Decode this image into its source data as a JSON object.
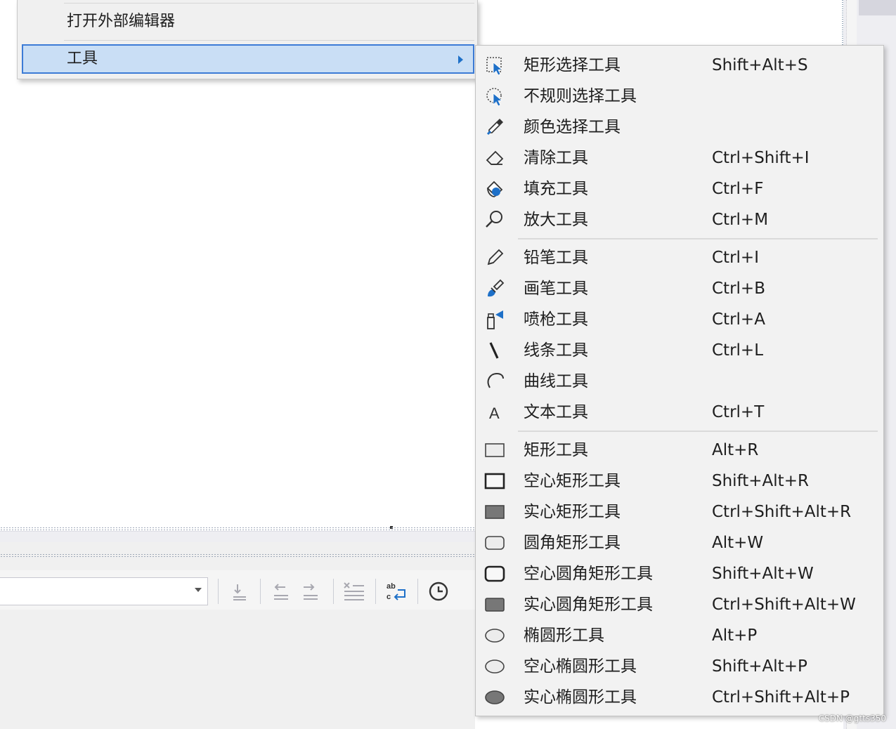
{
  "parent_menu": {
    "items": [
      {
        "label": "打开外部编辑器"
      },
      {
        "label": "工具"
      }
    ]
  },
  "submenu": {
    "groups": [
      [
        {
          "label": "矩形选择工具",
          "shortcut": "Shift+Alt+S",
          "icon": "rect-select-icon"
        },
        {
          "label": "不规则选择工具",
          "shortcut": "",
          "icon": "lasso-select-icon"
        },
        {
          "label": "颜色选择工具",
          "shortcut": "",
          "icon": "eyedropper-icon"
        },
        {
          "label": "清除工具",
          "shortcut": "Ctrl+Shift+I",
          "icon": "eraser-icon"
        },
        {
          "label": "填充工具",
          "shortcut": "Ctrl+F",
          "icon": "fill-bucket-icon"
        },
        {
          "label": "放大工具",
          "shortcut": "Ctrl+M",
          "icon": "zoom-icon"
        }
      ],
      [
        {
          "label": "铅笔工具",
          "shortcut": "Ctrl+I",
          "icon": "pencil-icon"
        },
        {
          "label": "画笔工具",
          "shortcut": "Ctrl+B",
          "icon": "brush-icon"
        },
        {
          "label": "喷枪工具",
          "shortcut": "Ctrl+A",
          "icon": "spray-icon"
        },
        {
          "label": "线条工具",
          "shortcut": "Ctrl+L",
          "icon": "line-icon"
        },
        {
          "label": "曲线工具",
          "shortcut": "",
          "icon": "curve-icon"
        },
        {
          "label": "文本工具",
          "shortcut": "Ctrl+T",
          "icon": "text-icon"
        }
      ],
      [
        {
          "label": "矩形工具",
          "shortcut": "Alt+R",
          "icon": "rect-icon"
        },
        {
          "label": "空心矩形工具",
          "shortcut": "Shift+Alt+R",
          "icon": "hollow-rect-icon"
        },
        {
          "label": "实心矩形工具",
          "shortcut": "Ctrl+Shift+Alt+R",
          "icon": "solid-rect-icon"
        },
        {
          "label": "圆角矩形工具",
          "shortcut": "Alt+W",
          "icon": "rounded-rect-icon"
        },
        {
          "label": "空心圆角矩形工具",
          "shortcut": "Shift+Alt+W",
          "icon": "hollow-rounded-rect-icon"
        },
        {
          "label": "实心圆角矩形工具",
          "shortcut": "Ctrl+Shift+Alt+W",
          "icon": "solid-rounded-rect-icon"
        },
        {
          "label": "椭圆形工具",
          "shortcut": "Alt+P",
          "icon": "ellipse-icon"
        },
        {
          "label": "空心椭圆形工具",
          "shortcut": "Shift+Alt+P",
          "icon": "hollow-ellipse-icon"
        },
        {
          "label": "实心椭圆形工具",
          "shortcut": "Ctrl+Shift+Alt+P",
          "icon": "solid-ellipse-icon"
        }
      ]
    ]
  },
  "watermark": "CSDN @gtts350",
  "colors": {
    "highlight_bg": "#c9def5",
    "highlight_border": "#3c7bd6",
    "menu_bg": "#f2f2f2",
    "accent_blue": "#1e70c8"
  }
}
